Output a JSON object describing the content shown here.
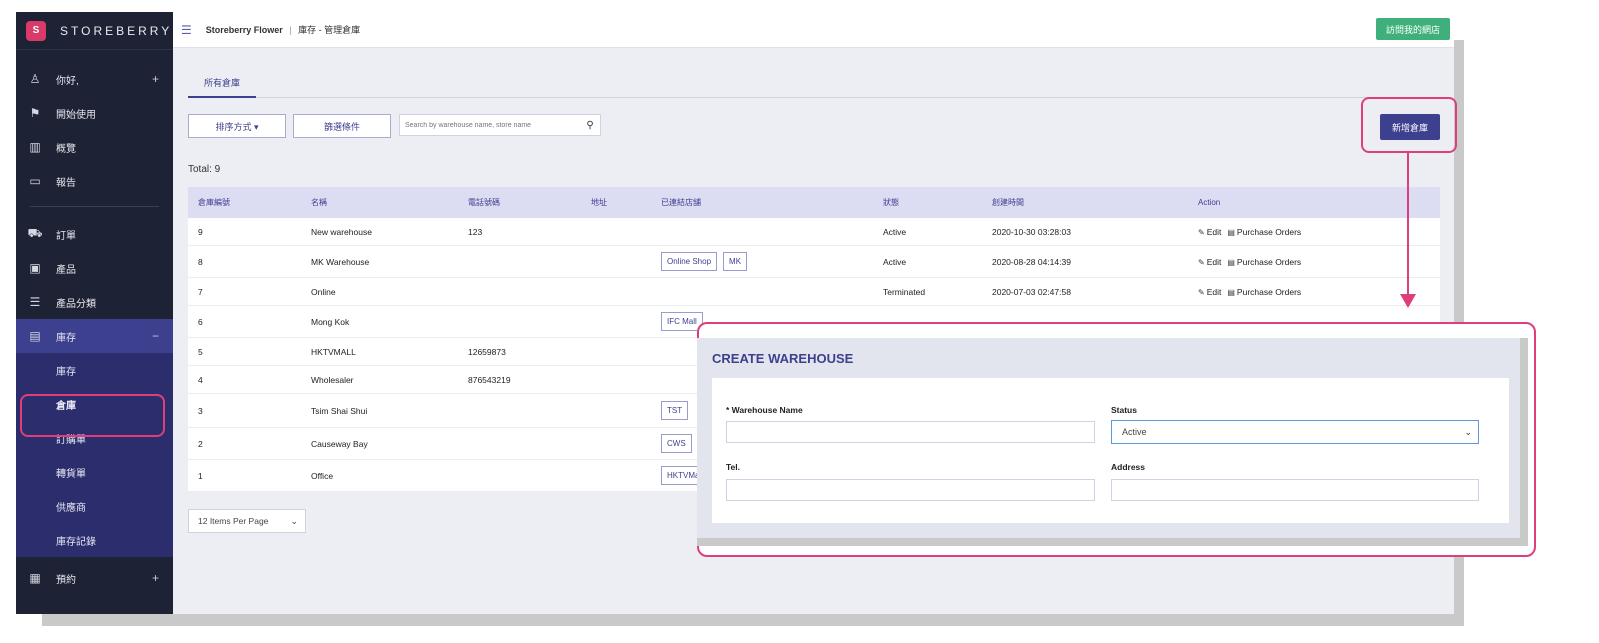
{
  "brand": {
    "logo_text": "S",
    "name": "STOREBERRY"
  },
  "sidebar": {
    "items": [
      {
        "icon": "user-icon",
        "glyph": "♙",
        "label": "你好,",
        "plus": "+"
      },
      {
        "icon": "flag-icon",
        "glyph": "⚑",
        "label": "開始使用"
      },
      {
        "icon": "chart-icon",
        "glyph": "▥",
        "label": "概覽"
      },
      {
        "icon": "file-icon",
        "glyph": "▭",
        "label": "報告"
      },
      {
        "icon": "cart-icon",
        "glyph": "⛟",
        "label": "訂單"
      },
      {
        "icon": "bag-icon",
        "glyph": "▣",
        "label": "產品"
      },
      {
        "icon": "list-icon",
        "glyph": "☰",
        "label": "產品分類"
      },
      {
        "icon": "inventory-icon",
        "glyph": "▤",
        "label": "庫存",
        "minus": "−"
      },
      {
        "icon": "calendar-icon",
        "glyph": "▦",
        "label": "預約",
        "plus": "+"
      }
    ],
    "sub_items": [
      "庫存",
      "倉庫",
      "訂購單",
      "轉貨單",
      "供應商",
      "庫存記錄"
    ]
  },
  "topbar": {
    "store": "Storeberry Flower",
    "divider": "|",
    "path": "庫存 - 管理倉庫",
    "visit_label": "訪問我的網店"
  },
  "tabs": [
    "所有倉庫"
  ],
  "toolbar": {
    "sort_label": "排序方式 ▾",
    "filter_label": "篩選條件",
    "search_placeholder": "Search by warehouse name, store name",
    "new_label": "新增倉庫"
  },
  "total": "Total: 9",
  "table": {
    "headers": [
      "倉庫編號",
      "名稱",
      "電話號碼",
      "地址",
      "已連結店舖",
      "狀態",
      "創建時間",
      "Action"
    ],
    "rows": [
      {
        "id": "9",
        "name": "New warehouse",
        "tel": "123",
        "address": "",
        "stores": [],
        "status": "Active",
        "created": "2020-10-30 03:28:03",
        "actions": true
      },
      {
        "id": "8",
        "name": "MK Warehouse",
        "tel": "",
        "address": "",
        "stores": [
          "Online Shop",
          "MK"
        ],
        "status": "Active",
        "created": "2020-08-28 04:14:39",
        "actions": true
      },
      {
        "id": "7",
        "name": "Online",
        "tel": "",
        "address": "",
        "stores": [],
        "status": "Terminated",
        "created": "2020-07-03 02:47:58",
        "actions": true
      },
      {
        "id": "6",
        "name": "Mong Kok",
        "tel": "",
        "address": "",
        "stores": [
          "IFC Mall"
        ],
        "status": "",
        "created": "",
        "actions": false
      },
      {
        "id": "5",
        "name": "HKTVMALL",
        "tel": "12659873",
        "address": "",
        "stores": [],
        "status": "",
        "created": "",
        "actions": false
      },
      {
        "id": "4",
        "name": "Wholesaler",
        "tel": "876543219",
        "address": "",
        "stores": [],
        "status": "",
        "created": "",
        "actions": false
      },
      {
        "id": "3",
        "name": "Tsim Shai Shui",
        "tel": "",
        "address": "",
        "stores": [
          "TST"
        ],
        "status": "",
        "created": "",
        "actions": false
      },
      {
        "id": "2",
        "name": "Causeway Bay",
        "tel": "",
        "address": "",
        "stores": [
          "CWS"
        ],
        "status": "",
        "created": "",
        "actions": false
      },
      {
        "id": "1",
        "name": "Office",
        "tel": "",
        "address": "",
        "stores": [
          "HKTVMall"
        ],
        "status": "",
        "created": "",
        "actions": false
      }
    ],
    "action_edit": "Edit",
    "action_po": "Purchase Orders"
  },
  "per_page": "12 Items Per Page",
  "create_warehouse": {
    "title": "CREATE WAREHOUSE",
    "name_label": "* Warehouse Name",
    "status_label": "Status",
    "status_value": "Active",
    "tel_label": "Tel.",
    "address_label": "Address"
  },
  "colors": {
    "accent": "#3d3f8f",
    "highlight": "#de3f7c",
    "visit": "#3fb07b",
    "sidebar": "#1e2235"
  }
}
